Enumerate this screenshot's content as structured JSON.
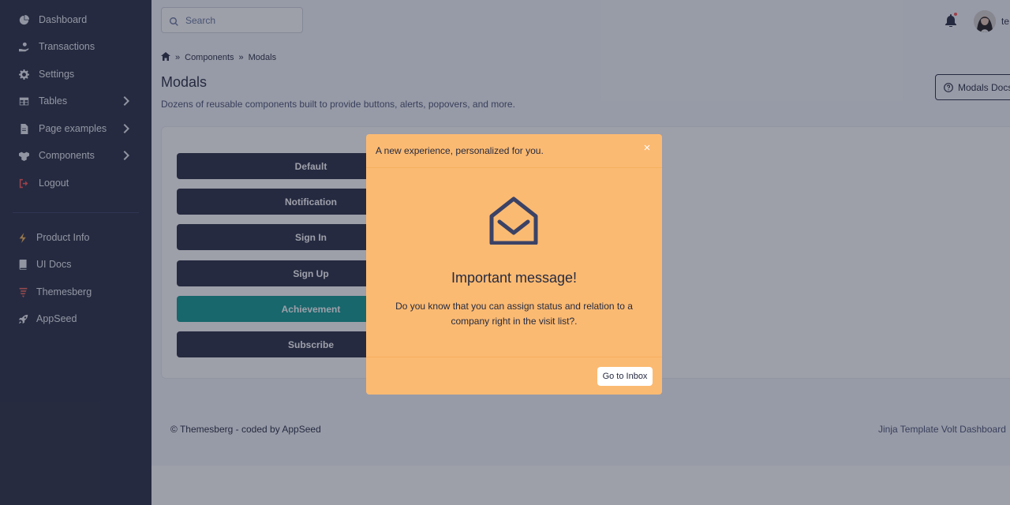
{
  "sidebar": {
    "items": [
      {
        "label": "Dashboard",
        "icon": "pie-chart-icon"
      },
      {
        "label": "Transactions",
        "icon": "hand-holding-dollar-icon"
      },
      {
        "label": "Settings",
        "icon": "gear-icon"
      },
      {
        "label": "Tables",
        "icon": "table-icon"
      },
      {
        "label": "Page examples",
        "icon": "file-icon"
      },
      {
        "label": "Components",
        "icon": "boxes-icon"
      },
      {
        "label": "Logout",
        "icon": "sign-out-icon"
      }
    ],
    "secondary": [
      {
        "label": "Product Info",
        "icon": "bolt-icon"
      },
      {
        "label": "UI Docs",
        "icon": "book-icon"
      },
      {
        "label": "Themesberg",
        "icon": "themesberg-logo-icon"
      },
      {
        "label": "AppSeed",
        "icon": "rocket-icon"
      }
    ]
  },
  "header": {
    "search_placeholder": "Search",
    "username": "te"
  },
  "breadcrumb": {
    "items": [
      "Components",
      "Modals"
    ]
  },
  "page": {
    "title": "Modals",
    "description": "Dozens of reusable components built to provide buttons, alerts, popovers, and more.",
    "docs_button": "Modals Docs"
  },
  "buttons": [
    "Default",
    "Notification",
    "Sign In",
    "Sign Up",
    "Achievement",
    "Subscribe"
  ],
  "footer": {
    "left": "© Themesberg - coded by AppSeed",
    "right": "Jinja Template Volt Dashboard"
  },
  "modal": {
    "header": "A new experience, personalized for you.",
    "close": "×",
    "title": "Important message!",
    "body": "Do you know that you can assign status and relation to a company right in the visit list?.",
    "button": "Go to Inbox"
  },
  "colors": {
    "sidebar": "#262b40",
    "modal": "#fbba72",
    "achievement": "#0c9a90",
    "notification_dot": "#fa5252"
  }
}
